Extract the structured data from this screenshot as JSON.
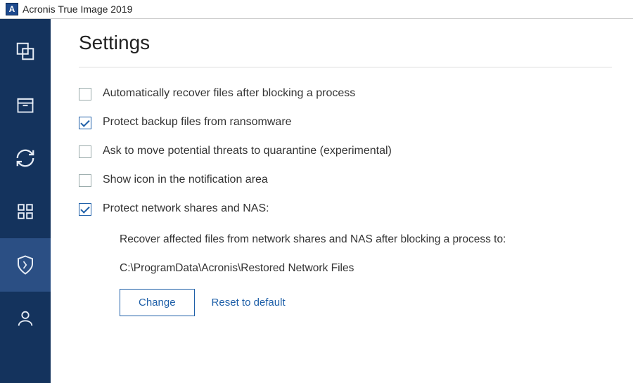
{
  "app": {
    "logo": "A",
    "title": "Acronis True Image 2019"
  },
  "sidebar": {
    "items": [
      {
        "name": "backup"
      },
      {
        "name": "archive"
      },
      {
        "name": "sync"
      },
      {
        "name": "tools"
      },
      {
        "name": "protection",
        "active": true
      },
      {
        "name": "account"
      }
    ]
  },
  "page": {
    "title": "Settings"
  },
  "settings": {
    "options": [
      {
        "label": "Automatically recover files after blocking a process",
        "checked": false
      },
      {
        "label": "Protect backup files from ransomware",
        "checked": true
      },
      {
        "label": "Ask to move potential threats to quarantine (experimental)",
        "checked": false
      },
      {
        "label": "Show icon in the notification area",
        "checked": false
      },
      {
        "label": "Protect network shares and NAS:",
        "checked": true
      }
    ],
    "nas_description": "Recover affected files from network shares and NAS after blocking a process to:",
    "nas_path": "C:\\ProgramData\\Acronis\\Restored Network Files",
    "change_label": "Change",
    "reset_label": "Reset to default"
  }
}
